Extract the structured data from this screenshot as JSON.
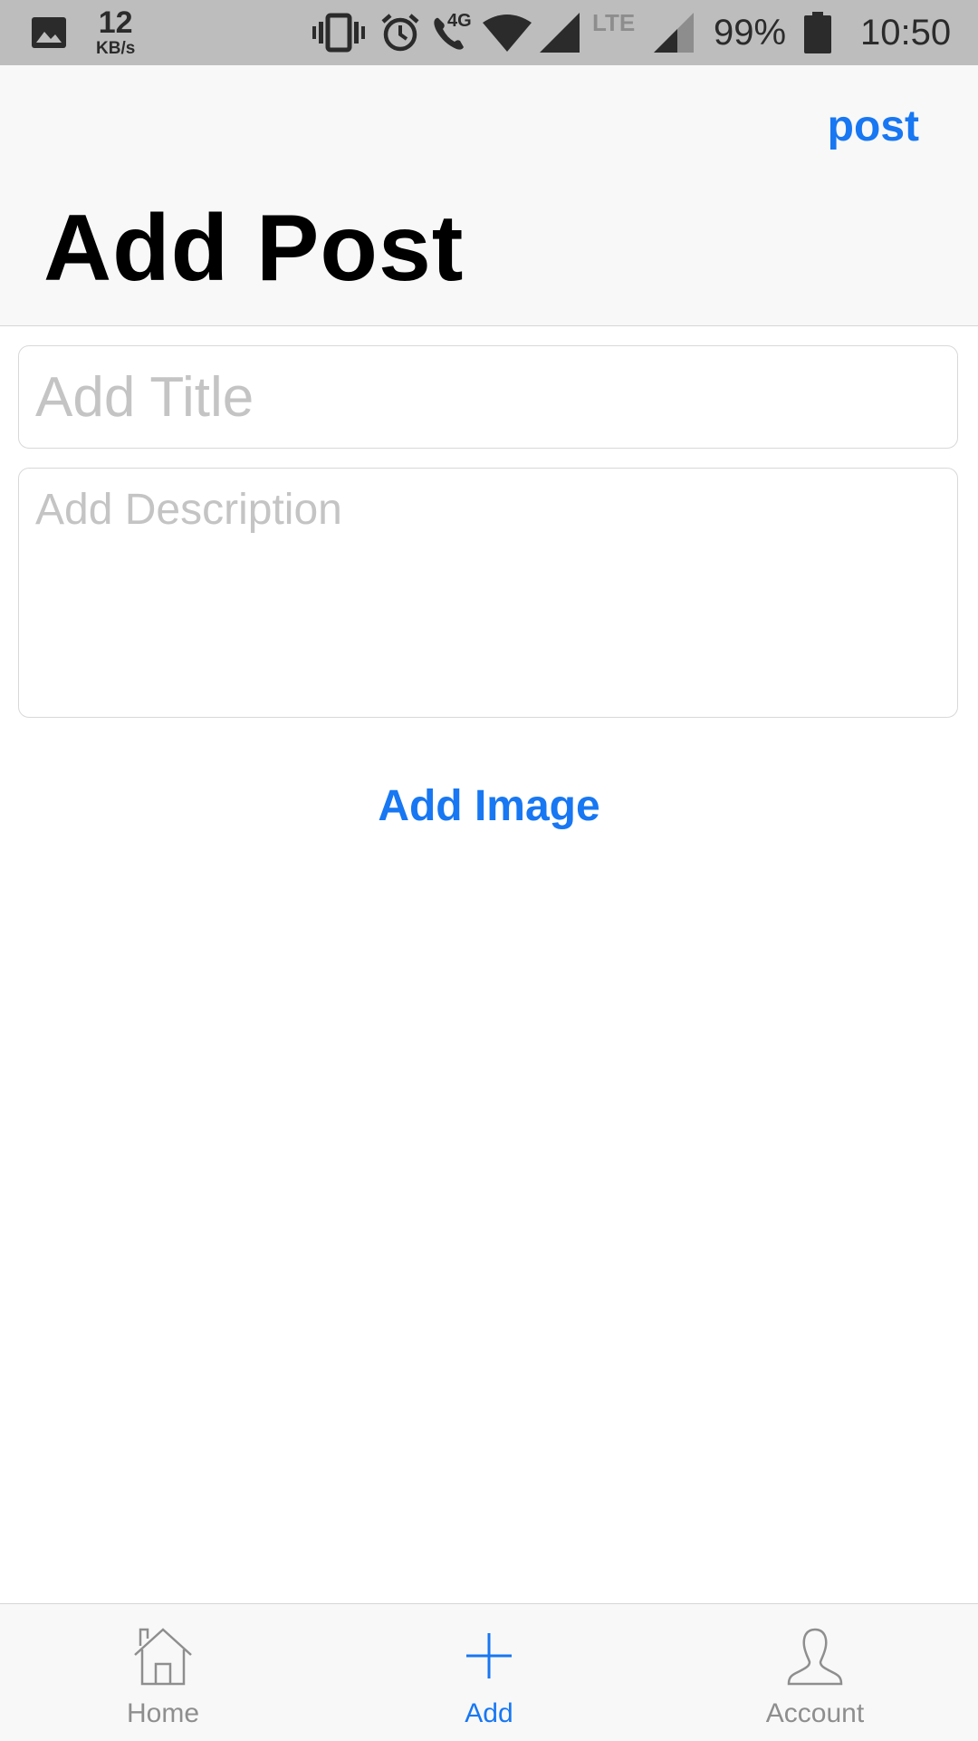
{
  "status_bar": {
    "speed_value": "12",
    "speed_unit": "KB/s",
    "network_label": "4G",
    "lte_label": "LTE",
    "battery_percent": "99%",
    "time": "10:50",
    "icons": [
      "image-icon",
      "vibrate-icon",
      "alarm-icon",
      "wifi-call-icon",
      "wifi-icon",
      "signal-icon",
      "signal-icon-2",
      "battery-icon"
    ]
  },
  "header": {
    "post_label": "post",
    "title": "Add Post"
  },
  "form": {
    "title_placeholder": "Add Title",
    "description_placeholder": "Add Description",
    "add_image_label": "Add Image"
  },
  "tab_bar": {
    "tabs": [
      {
        "label": "Home",
        "icon": "home-icon",
        "active": false
      },
      {
        "label": "Add",
        "icon": "plus-icon",
        "active": true
      },
      {
        "label": "Account",
        "icon": "account-icon",
        "active": false
      }
    ]
  },
  "colors": {
    "accent": "#1877f2",
    "inactive": "#8e8e8e",
    "status_bar_bg": "#bdbdbd",
    "header_bg": "#f8f8f8"
  }
}
